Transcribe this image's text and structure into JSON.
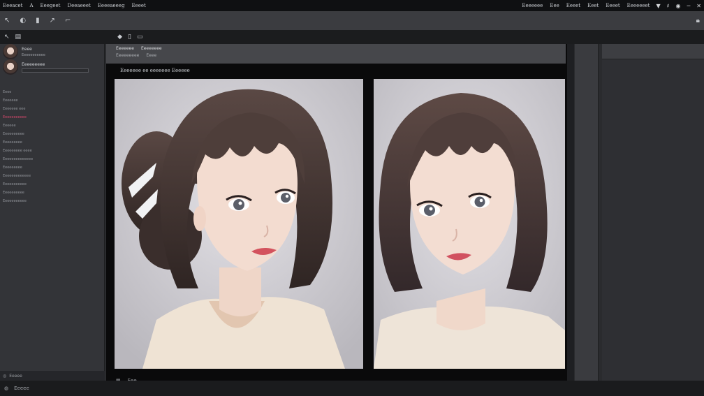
{
  "menubar": {
    "left_items": [
      "Eeeacet",
      "A",
      "Eeegeet",
      "Deeaeeet",
      "Eeeeaeeeg",
      "Eeeet"
    ],
    "right_items": [
      "Eeeeeee",
      "Eee",
      "Eeeet",
      "Eeet",
      "Eeeet",
      "Eeeeeeet"
    ]
  },
  "subbar": {
    "title": ""
  },
  "left_panel": {
    "layers": [
      {
        "name": "Eeee",
        "sub": "Eeeeeeeeeee",
        "has_field": false
      },
      {
        "name": "Eeeeeeeee",
        "sub": "",
        "has_field": true
      }
    ],
    "props": [
      {
        "label": "Eeee",
        "red": false
      },
      {
        "label": "Eeeeeee",
        "red": false
      },
      {
        "label": "Eeeeeee eee",
        "red": false
      },
      {
        "label": "Eeeeeeeeeee",
        "red": true
      },
      {
        "label": "Eeeeee",
        "red": false
      },
      {
        "label": "Eeeeeeeeee",
        "red": false
      },
      {
        "label": "Eeeeeeeee",
        "red": false
      },
      {
        "label": "Eeeeeeeee eeee",
        "red": false
      },
      {
        "label": "Eeeeeeeeeeeeee",
        "red": false
      },
      {
        "label": "Eeeeeeeee",
        "red": false
      },
      {
        "label": "Eeeeeeeeeeeee",
        "red": false
      },
      {
        "label": "Eeeeeeeeeee",
        "red": false
      },
      {
        "label": "Eeeeeeeeee",
        "red": false
      },
      {
        "label": "Eeeeeeeeeee",
        "red": false
      }
    ],
    "footer": "Eeeee"
  },
  "canvas": {
    "tabs_row1": [
      "Eeeeeee",
      "Eeeeeeee"
    ],
    "tabs_row2": [
      "Eeeeeeeee",
      "Eeee"
    ],
    "title": "Eeeeeee ee eeeeeee Eeeeee",
    "footer": "Eee"
  },
  "statusbar": {
    "left": "Eeeee",
    "right": ""
  }
}
